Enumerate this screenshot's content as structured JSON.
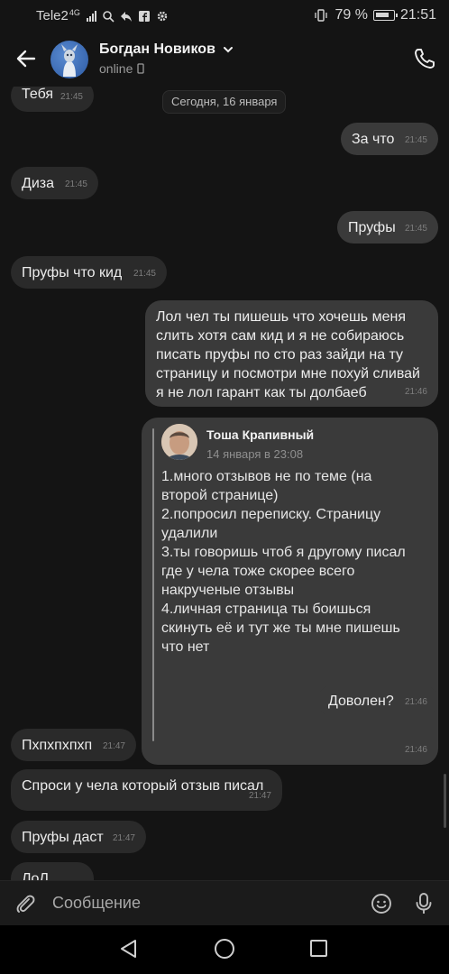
{
  "status_bar": {
    "carrier": "Tele2",
    "network_type": "4G",
    "battery_percent": "79 %",
    "time": "21:51"
  },
  "header": {
    "contact_name": "Богдан Новиков",
    "status": "online"
  },
  "date_separator": "Сегодня, 16 января",
  "messages": [
    {
      "text": "Тебя",
      "time": "21:45",
      "direction": "in"
    },
    {
      "text": "За что",
      "time": "21:45",
      "direction": "out"
    },
    {
      "text": "Диза",
      "time": "21:45",
      "direction": "in"
    },
    {
      "text": "Пруфы",
      "time": "21:45",
      "direction": "out"
    },
    {
      "text": "Пруфы что кид",
      "time": "21:45",
      "direction": "in"
    },
    {
      "text": "Лол чел ты пишешь что хочешь меня слить хотя сам кид и я не собираюсь писать пруфы по сто раз  зайди на ту страницу и посмотри мне похуй сливай я не лол гарант как ты долбаеб",
      "time": "21:46",
      "direction": "out"
    },
    {
      "text": "",
      "time": "21:46",
      "direction": "out"
    },
    {
      "text": "Доволен?",
      "time": "21:46",
      "direction": "out"
    },
    {
      "text": "Пхпхпхпхп",
      "time": "21:47",
      "direction": "in"
    },
    {
      "text": "Спроси у чела который отзыв писал",
      "time": "21:47",
      "direction": "in"
    },
    {
      "text": "Пруфы даст",
      "time": "21:47",
      "direction": "in"
    },
    {
      "text": "ЛоЛ",
      "time": "",
      "direction": "in"
    }
  ],
  "forwarded": {
    "author": "Тоша Крапивный",
    "date": "14 января в 23:08",
    "lines": [
      "1.много отзывов не по теме (на второй странице)",
      "2.попросил переписку. Страницу удалили",
      "3.ты говоришь чтоб я другому писал где у чела тоже скорее всего накрученые отзывы",
      "4.личная страница ты боишься скинуть её и тут же ты мне пишешь что нет"
    ]
  },
  "composer": {
    "placeholder": "Сообщение"
  },
  "icons": {
    "back": "arrow-left-icon",
    "phone": "phone-icon",
    "attach": "paperclip-icon",
    "emoji": "smile-icon",
    "mic": "microphone-icon"
  }
}
